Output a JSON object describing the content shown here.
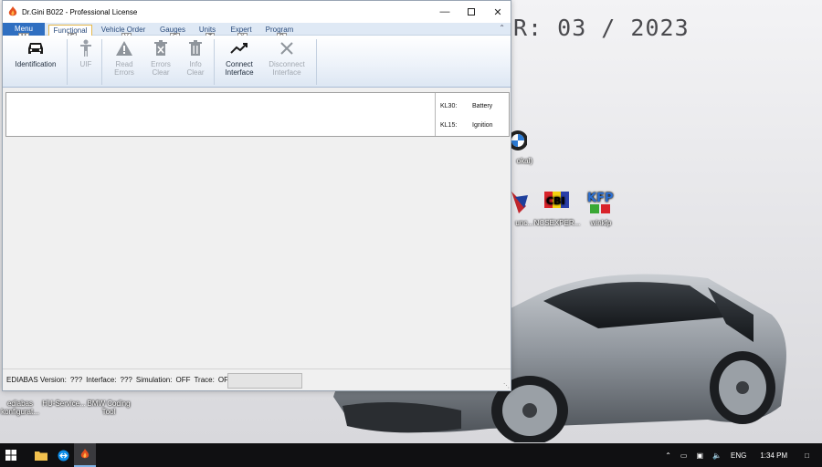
{
  "window": {
    "title": "Dr.Gini B022 - Professional License"
  },
  "ribbon": {
    "tabs": [
      {
        "label": "Menu",
        "keytip": "M"
      },
      {
        "label": "Functional",
        "keytip": "F"
      },
      {
        "label": "Vehicle Order",
        "keytip": "V"
      },
      {
        "label": "Gauges",
        "keytip": "G"
      },
      {
        "label": "Units",
        "keytip": "T"
      },
      {
        "label": "Expert",
        "keytip": "X"
      },
      {
        "label": "Program",
        "keytip": "P"
      }
    ],
    "buttons": [
      {
        "line1": "Identification",
        "line2": "",
        "icon": "car-icon",
        "enabled": true
      },
      {
        "line1": "UIF",
        "line2": "",
        "icon": "person-icon",
        "enabled": false
      },
      {
        "line1": "Read",
        "line2": "Errors",
        "icon": "warning-icon",
        "enabled": false
      },
      {
        "line1": "Errors",
        "line2": "Clear",
        "icon": "error-clear-icon",
        "enabled": false
      },
      {
        "line1": "Info",
        "line2": "Clear",
        "icon": "trash-icon",
        "enabled": false
      },
      {
        "line1": "Connect",
        "line2": "Interface",
        "icon": "connect-icon",
        "enabled": true
      },
      {
        "line1": "Disconnect",
        "line2": "Interface",
        "icon": "disconnect-icon",
        "enabled": false
      }
    ]
  },
  "info_panel": {
    "kl30_label": "KL30:",
    "kl30_value": "Battery",
    "kl15_label": "KL15:",
    "kl15_value": "Ignition"
  },
  "status": {
    "ediabas_label": "EDIABAS Version:",
    "ediabas_value": "???",
    "interface_label": "Interface:",
    "interface_value": "???",
    "simulation_label": "Simulation:",
    "simulation_value": "OFF",
    "trace_label": "Trace:",
    "trace_value": "OFF"
  },
  "desktop": {
    "bg_text": "R: 03 / 2023",
    "icons": [
      {
        "line1": "ediabas",
        "line2": "konfigurat..."
      },
      {
        "line1": "HU-Service...",
        "line2": ""
      },
      {
        "line1": "BMW Coding",
        "line2": "Tool"
      },
      {
        "line1": "okal)",
        "line2": ""
      },
      {
        "line1": "unc...",
        "line2": ""
      },
      {
        "line1": "NCSEXPER...",
        "line2": ""
      },
      {
        "line1": "winkfp",
        "line2": ""
      }
    ]
  },
  "taskbar": {
    "language": "ENG",
    "time": "1:34 PM"
  },
  "colors": {
    "ribbon_menu": "#2f6fc1",
    "ribbon_accent": "#e6b84a"
  }
}
